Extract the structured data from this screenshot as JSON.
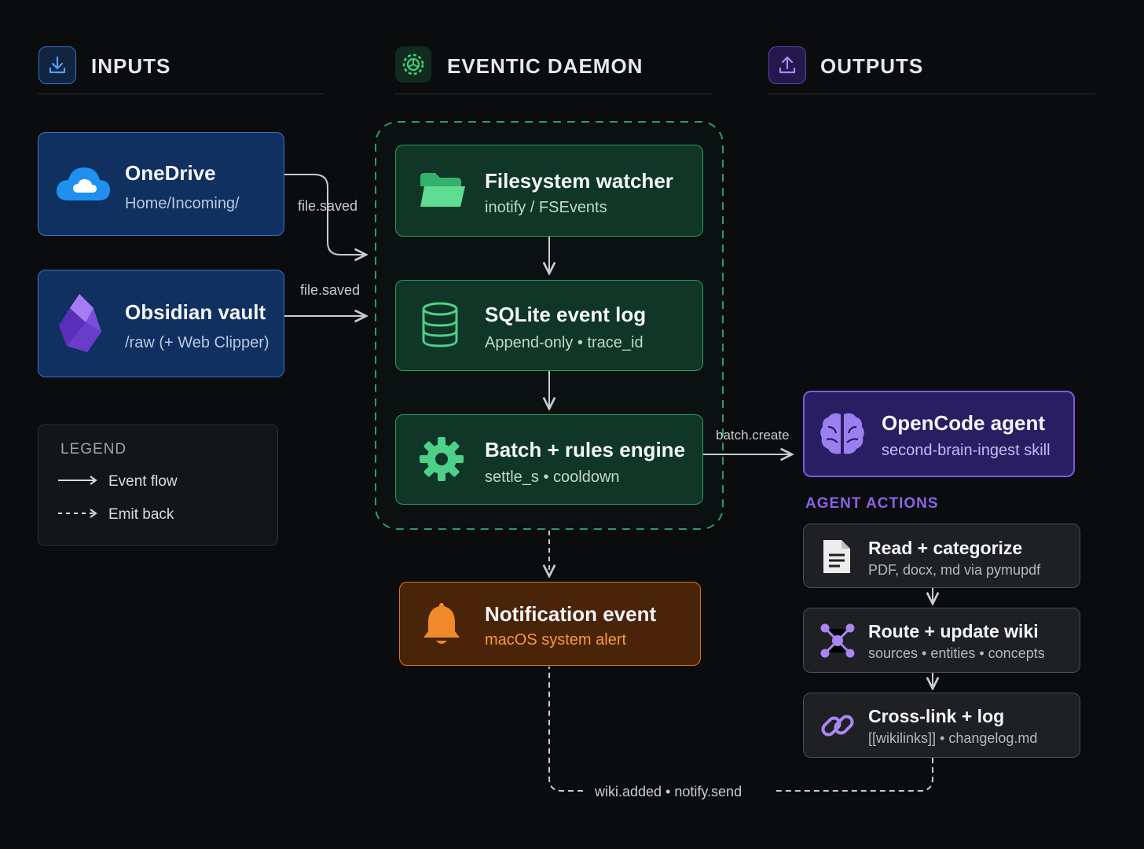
{
  "sections": {
    "inputs": {
      "title": "INPUTS",
      "icon": "download-icon"
    },
    "daemon": {
      "title": "EVENTIC DAEMON",
      "icon": "gear-cycle-icon"
    },
    "outputs": {
      "title": "OUTPUTS",
      "icon": "upload-icon"
    }
  },
  "inputs": {
    "onedrive": {
      "title": "OneDrive",
      "sub": "Home/Incoming/",
      "icon": "cloud-icon"
    },
    "obsidian": {
      "title": "Obsidian vault",
      "sub": "/raw (+ Web Clipper)",
      "icon": "obsidian-gem-icon"
    }
  },
  "daemon": {
    "watcher": {
      "title": "Filesystem watcher",
      "sub": "inotify / FSEvents",
      "icon": "folder-icon"
    },
    "eventlog": {
      "title": "SQLite event log",
      "sub": "Append-only • trace_id",
      "icon": "database-icon"
    },
    "rules": {
      "title": "Batch + rules engine",
      "sub": "settle_s • cooldown",
      "icon": "gear-icon"
    }
  },
  "notification": {
    "title": "Notification event",
    "sub": "macOS system alert",
    "icon": "bell-icon"
  },
  "agent": {
    "title": "OpenCode agent",
    "sub": "second-brain-ingest skill",
    "icon": "brain-icon"
  },
  "agent_actions": {
    "heading": "AGENT ACTIONS",
    "items": [
      {
        "title": "Read + categorize",
        "sub": "PDF, docx, md via pymupdf",
        "icon": "document-icon"
      },
      {
        "title": "Route + update wiki",
        "sub": "sources • entities • concepts",
        "icon": "network-icon"
      },
      {
        "title": "Cross-link + log",
        "sub": "[[wikilinks]] • changelog.md",
        "icon": "link-icon"
      }
    ]
  },
  "edges": {
    "onedrive_label": "file.saved",
    "obsidian_label": "file.saved",
    "batch_label": "batch.create",
    "emit_label": "wiki.added • notify.send"
  },
  "legend": {
    "title": "LEGEND",
    "event_flow": "Event flow",
    "emit_back": "Emit back"
  },
  "colors": {
    "background": "#0b0c0e",
    "input_blue": "#3a6fd0",
    "daemon_green": "#2d9c63",
    "notify_orange": "#d8731f",
    "agent_purple": "#7c5ae0"
  }
}
